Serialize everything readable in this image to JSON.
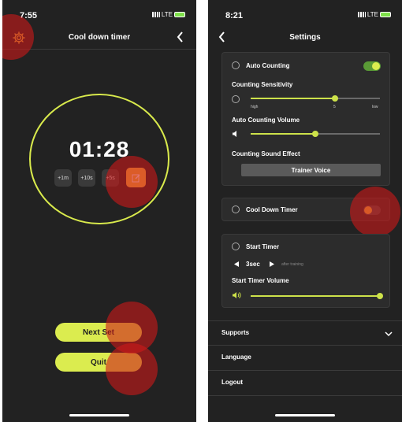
{
  "left": {
    "status_time": "7:55",
    "network": "LTE",
    "title": "Cool down timer",
    "timer": "01:28",
    "add_buttons": [
      "+1m",
      "+10s",
      "+5s"
    ],
    "next_set": "Next Set",
    "quit": "Quit"
  },
  "right": {
    "status_time": "8:21",
    "network": "LTE",
    "title": "Settings",
    "auto_counting": {
      "label": "Auto Counting",
      "enabled": true
    },
    "counting_sensitivity": {
      "label": "Counting Sensitivity",
      "low_label": "high",
      "mid_label": "5",
      "high_label": "low",
      "value": 0.55
    },
    "auto_counting_volume": {
      "label": "Auto Counting Volume",
      "value": 0.5
    },
    "counting_sound_effect": {
      "label": "Counting Sound Effect",
      "option": "Trainer Voice"
    },
    "cool_down_timer": {
      "label": "Cool Down Timer",
      "enabled": false
    },
    "start_timer": {
      "label": "Start Timer",
      "value": "3sec",
      "hint": "after training"
    },
    "start_timer_volume": {
      "label": "Start Timer Volume",
      "value": 1.0
    },
    "menu": [
      "Supports",
      "Language",
      "Logout"
    ]
  },
  "colors": {
    "accent": "#dbec4f",
    "toggle_on": "#5a9a36",
    "edit": "#f0c040",
    "background": "#222222"
  }
}
